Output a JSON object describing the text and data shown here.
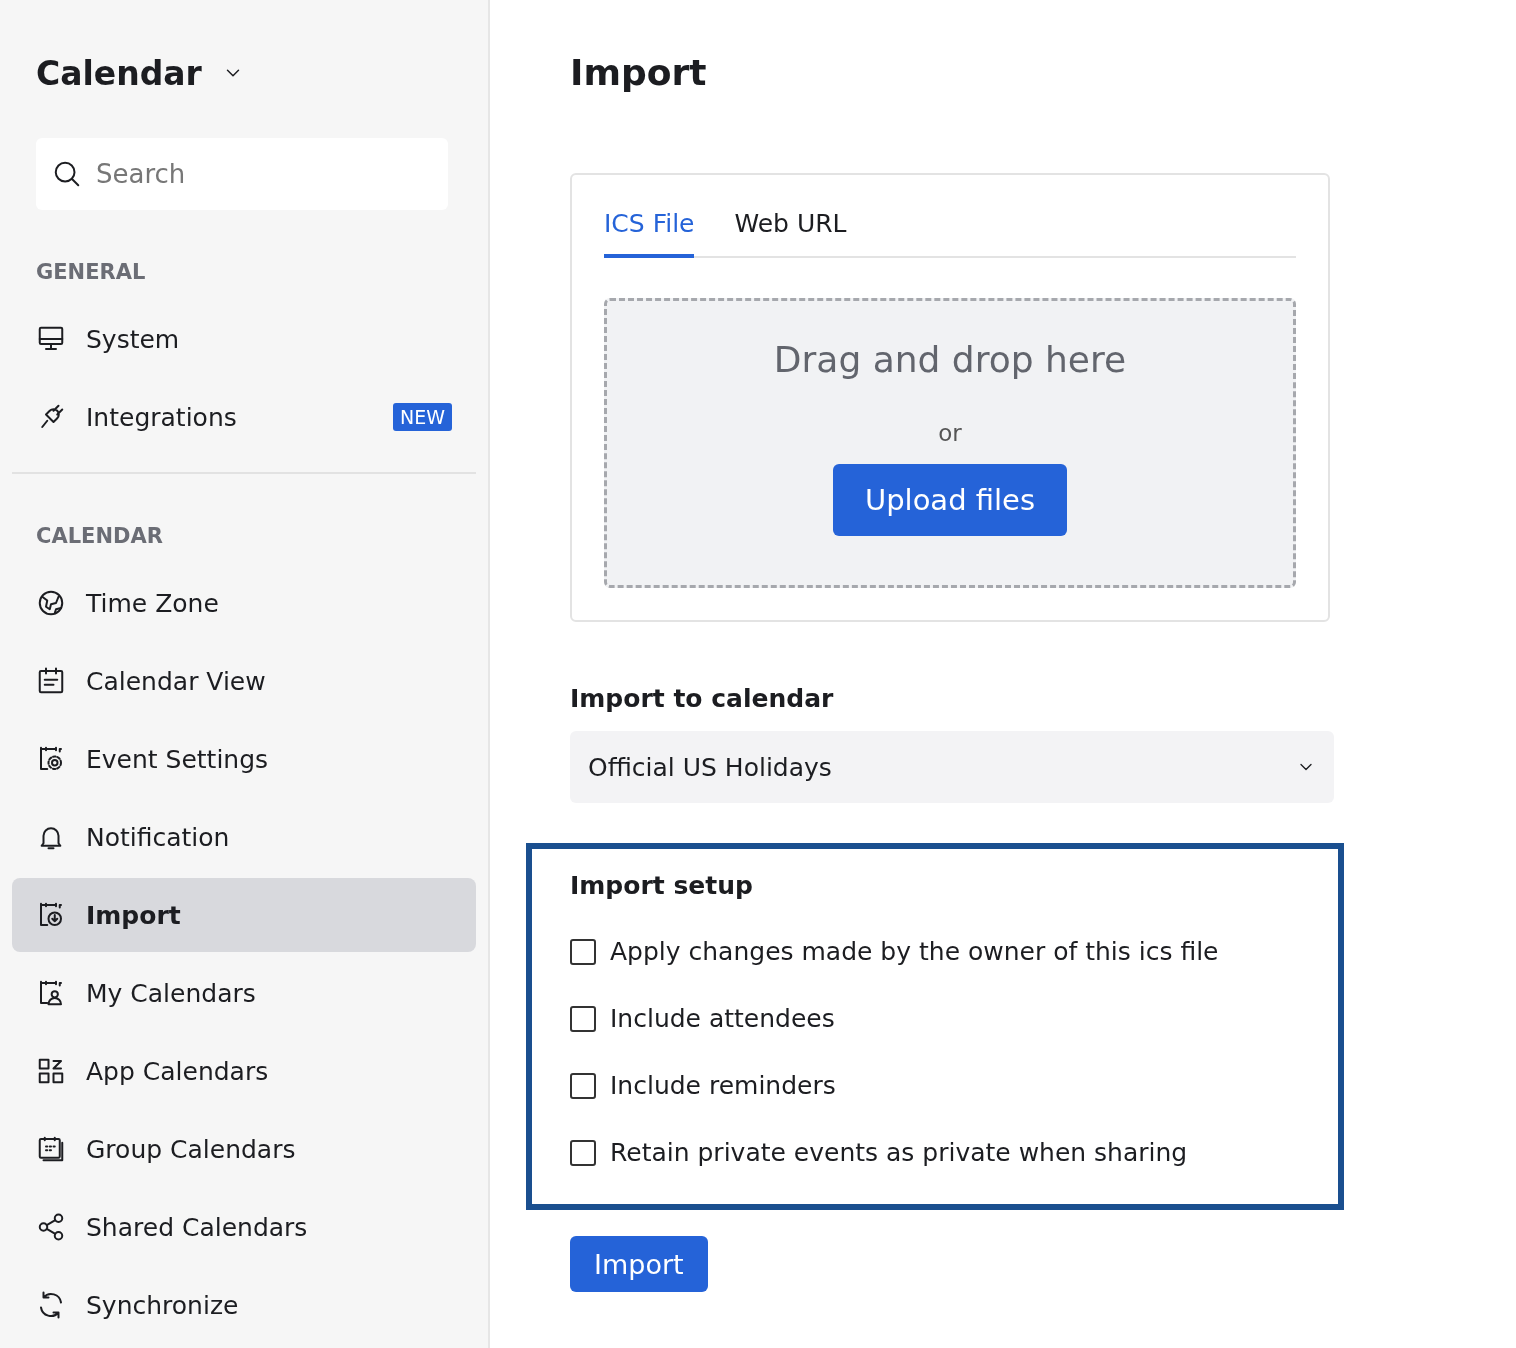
{
  "sidebar": {
    "title": "Calendar",
    "search": {
      "placeholder": "Search"
    },
    "sections": [
      {
        "heading": "GENERAL",
        "items": [
          {
            "label": "System",
            "selected": false
          },
          {
            "label": "Integrations",
            "selected": false,
            "badge": "NEW"
          }
        ]
      },
      {
        "heading": "CALENDAR",
        "items": [
          {
            "label": "Time Zone",
            "selected": false
          },
          {
            "label": "Calendar View",
            "selected": false
          },
          {
            "label": "Event Settings",
            "selected": false
          },
          {
            "label": "Notification",
            "selected": false
          },
          {
            "label": "Import",
            "selected": true
          },
          {
            "label": "My Calendars",
            "selected": false
          },
          {
            "label": "App Calendars",
            "selected": false
          },
          {
            "label": "Group Calendars",
            "selected": false
          },
          {
            "label": "Shared Calendars",
            "selected": false
          },
          {
            "label": "Synchronize",
            "selected": false
          }
        ]
      }
    ]
  },
  "main": {
    "title": "Import",
    "tabs": [
      {
        "label": "ICS File",
        "selected": true
      },
      {
        "label": "Web URL",
        "selected": false
      }
    ],
    "dropzone": {
      "text": "Drag and drop here",
      "or": "or",
      "button": "Upload files"
    },
    "calendar_label": "Import to calendar",
    "calendar_select": {
      "value": "Official US Holidays"
    },
    "setup": {
      "title": "Import setup",
      "options": [
        {
          "label": "Apply changes made by the owner of this ics file",
          "checked": false
        },
        {
          "label": "Include attendees",
          "checked": false
        },
        {
          "label": "Include reminders",
          "checked": false
        },
        {
          "label": "Retain private events as private when sharing",
          "checked": false
        }
      ]
    },
    "import_button": "Import"
  }
}
